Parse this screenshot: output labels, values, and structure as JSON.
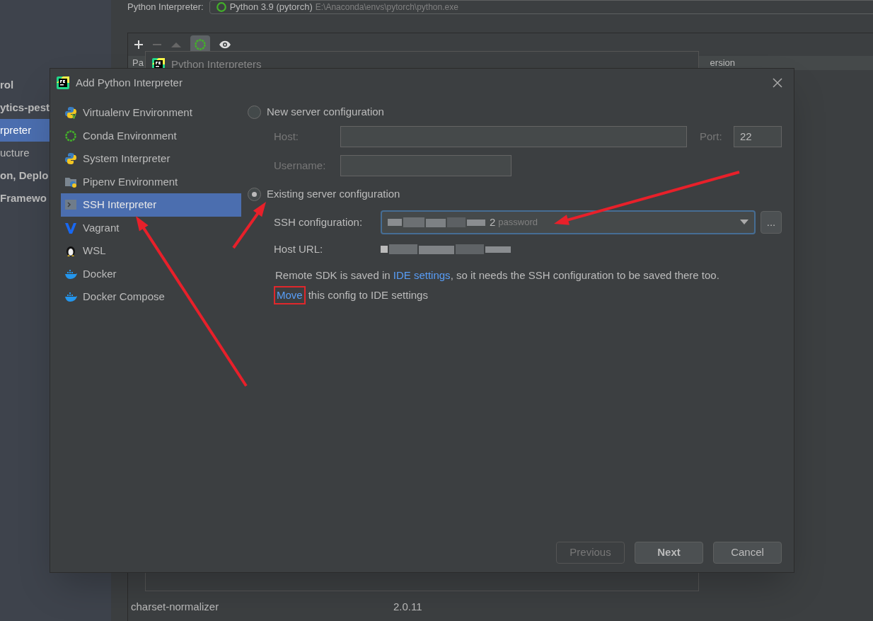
{
  "background": {
    "sidebar": [
      {
        "label": "rol",
        "bold": true,
        "selected": false
      },
      {
        "label": "ytics-pest",
        "bold": true,
        "selected": false
      },
      {
        "label": "rpreter",
        "bold": false,
        "selected": true
      },
      {
        "label": "ucture",
        "bold": false,
        "selected": false
      },
      {
        "label": "on, Deplo",
        "bold": true,
        "selected": false
      },
      {
        "label": "Framewo",
        "bold": true,
        "selected": false
      }
    ],
    "interpreter_label": "Python Interpreter:",
    "interpreter_value": "Python 3.9 (pytorch)",
    "interpreter_path": "E:\\Anaconda\\envs\\pytorch\\python.exe",
    "table_header": [
      "Pa",
      "ersion"
    ],
    "rows": [
      {
        "package": "charset-normalizer",
        "version": "2.0.11"
      }
    ]
  },
  "interpreters_dialog": {
    "title": "Python Interpreters"
  },
  "dialog": {
    "title": "Add Python Interpreter",
    "types": [
      {
        "label": "Virtualenv Environment",
        "kind": "virtualenv",
        "selected": false
      },
      {
        "label": "Conda Environment",
        "kind": "conda",
        "selected": false
      },
      {
        "label": "System Interpreter",
        "kind": "python",
        "selected": false
      },
      {
        "label": "Pipenv Environment",
        "kind": "pipenv",
        "selected": false
      },
      {
        "label": "SSH Interpreter",
        "kind": "ssh",
        "selected": true
      },
      {
        "label": "Vagrant",
        "kind": "vagrant",
        "selected": false
      },
      {
        "label": "WSL",
        "kind": "wsl",
        "selected": false
      },
      {
        "label": "Docker",
        "kind": "docker",
        "selected": false
      },
      {
        "label": "Docker Compose",
        "kind": "docker",
        "selected": false
      }
    ],
    "new_server": {
      "label": "New server configuration",
      "selected": false,
      "host_label": "Host:",
      "port_label": "Port:",
      "port": "22",
      "username_label": "Username:"
    },
    "existing_server": {
      "label": "Existing server configuration",
      "selected": true,
      "ssh_label": "SSH configuration:",
      "ssh_value": "2",
      "ssh_hint": "password",
      "browse": "...",
      "host_url_label": "Host URL:"
    },
    "note": "Remote SDK is saved in ",
    "note_link": "IDE settings",
    "note_rest": ", so it needs the SSH configuration to be saved there too.",
    "move_link": "Move",
    "move_rest": "this config to IDE settings",
    "buttons": [
      {
        "label": "Previous",
        "disabled": true,
        "primary": false
      },
      {
        "label": "Next",
        "disabled": false,
        "primary": true
      },
      {
        "label": "Cancel",
        "disabled": false,
        "primary": false
      }
    ]
  }
}
